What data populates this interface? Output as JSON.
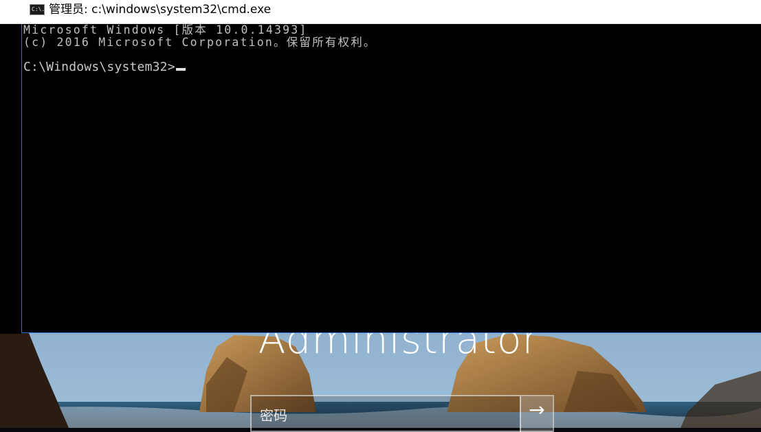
{
  "window": {
    "title": "管理员: c:\\windows\\system32\\cmd.exe",
    "icon": "cmd-app-icon",
    "icon_text": "C:\\."
  },
  "console": {
    "lines": [
      "Microsoft Windows [版本 10.0.14393]",
      "(c) 2016 Microsoft Corporation。保留所有权利。",
      ""
    ],
    "prompt": "C:\\Windows\\system32>",
    "background": "#000000",
    "text_color": "#c0c0c0"
  },
  "lockscreen": {
    "user_name": "Administrator",
    "password_placeholder": "密码",
    "submit_icon": "arrow-right-icon",
    "submit_glyph": "→"
  },
  "colors": {
    "window_accent": "#2f73c4",
    "titlebar": "#ffffff"
  }
}
